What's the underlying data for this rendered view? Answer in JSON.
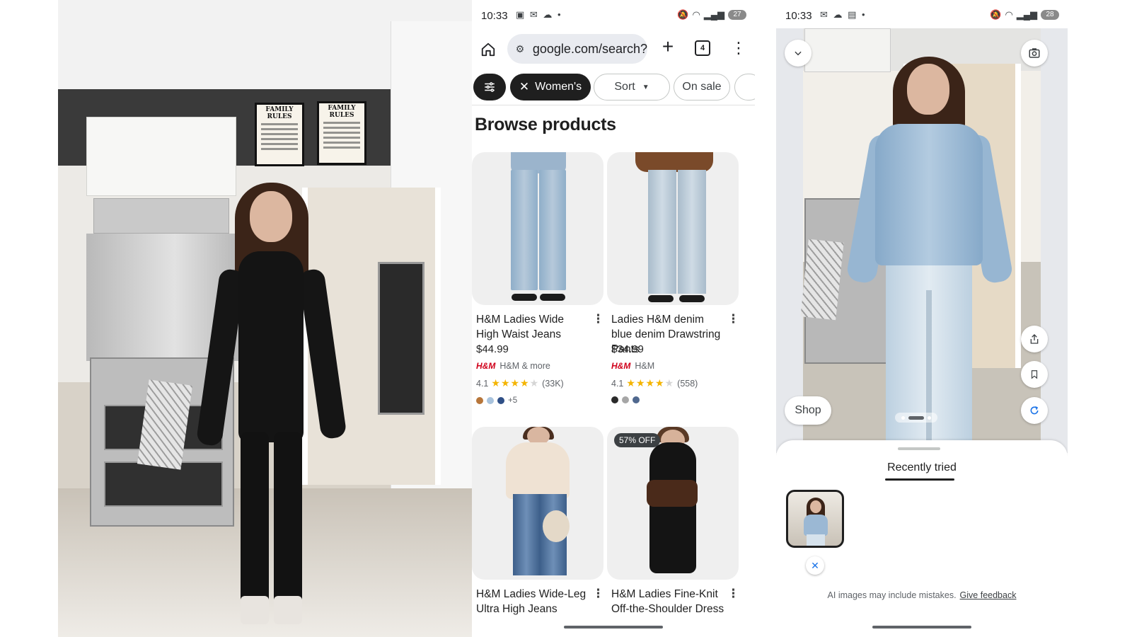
{
  "photo_panel": {
    "sign_left": "FAMILY RULES",
    "sign_right": "FAMILY RULES"
  },
  "phone_left": {
    "status": {
      "time": "10:33",
      "icons": "▣ ✉ ☁ •",
      "battery": "27"
    },
    "toolbar": {
      "url": "google.com/search?",
      "tab_count": "4"
    },
    "chips": {
      "filter_icon": "tune-icon",
      "women": "Women's",
      "sort": "Sort",
      "on_sale": "On sale"
    },
    "section_title": "Browse products",
    "products": [
      {
        "title": "H&M Ladies Wide High Waist Jeans",
        "price": "$44.99",
        "seller_logo": "H&M",
        "seller": "H&M & more",
        "rating": "4.1",
        "review_count": "(33K)",
        "stars_filled": 4,
        "swatch_colors": [
          "#b7763a",
          "#a9c3dd",
          "#2f4f86"
        ],
        "more_colors": "+5"
      },
      {
        "title": "Ladies H&M denim blue denim Drawstring Pants",
        "price": "$34.99",
        "seller_logo": "H&M",
        "seller": "H&M",
        "rating": "4.1",
        "review_count": "(558)",
        "stars_filled": 4,
        "swatch_colors": [
          "#2a2a2a",
          "#a6a6a6",
          "#50688e"
        ],
        "more_colors": ""
      },
      {
        "title": "H&M Ladies Wide-Leg Ultra High Jeans"
      },
      {
        "title": "H&M Ladies Fine-Knit Off-the-Shoulder Dress",
        "badge": "57% OFF"
      }
    ]
  },
  "phone_right": {
    "status": {
      "time": "10:33",
      "icons": "✉ ☁ ▤ •",
      "battery": "28"
    },
    "shop_label": "Shop",
    "sheet_title": "Recently tried",
    "disclaimer": "AI images may include mistakes.",
    "feedback_link": "Give feedback"
  }
}
